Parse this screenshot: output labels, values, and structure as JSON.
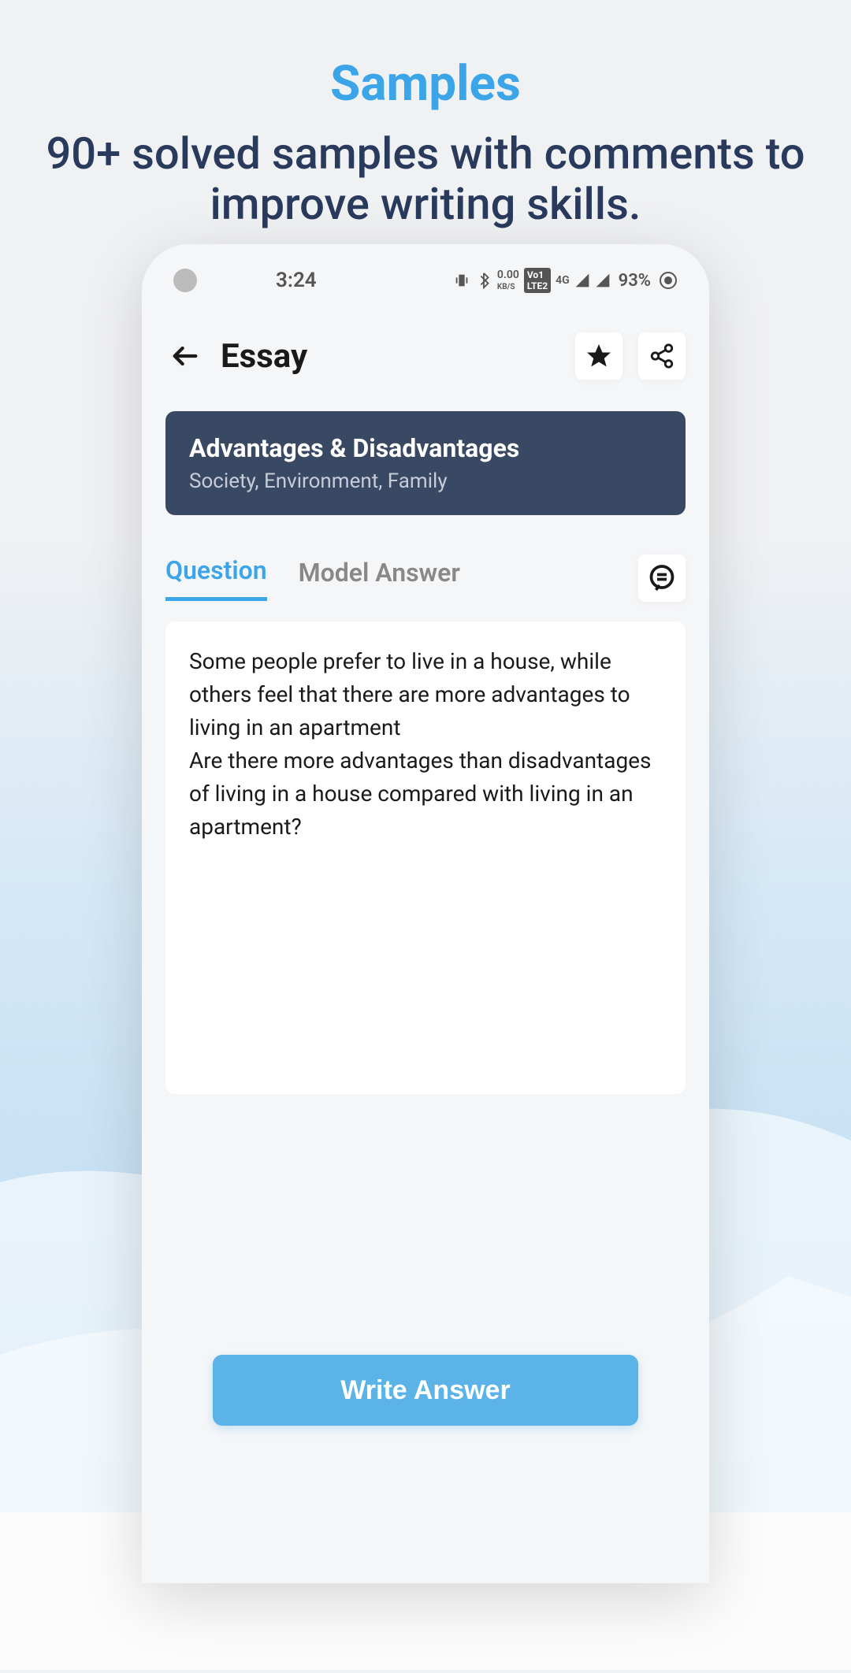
{
  "promo": {
    "title": "Samples",
    "subtitle": "90+ solved samples with comments to improve writing skills."
  },
  "status_bar": {
    "time": "3:24",
    "network_speed": "0.00",
    "network_unit": "KB/S",
    "signal_label": "4G",
    "battery": "93%"
  },
  "app": {
    "back_label": "Back",
    "title": "Essay",
    "star_label": "Favorite",
    "share_label": "Share"
  },
  "category": {
    "title": "Advantages & Disadvantages",
    "subtitle": "Society, Environment, Family"
  },
  "tabs": {
    "question": "Question",
    "model_answer": "Model Answer",
    "comment_label": "Comments"
  },
  "content": {
    "question": "Some people prefer to live in a house, while others feel that there are more advantages to living in an apartment\nAre there more advantages than disadvantages of living in a house compared with living in an apartment?"
  },
  "actions": {
    "write_answer": "Write Answer"
  }
}
